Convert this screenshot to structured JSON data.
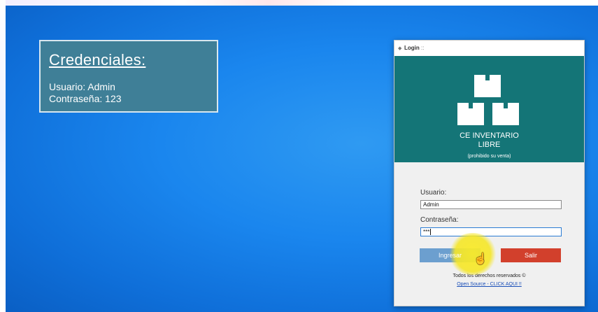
{
  "credentials": {
    "title": "Credenciales:",
    "user_line": "Usuario: Admin",
    "pass_line": "Contraseña: 123"
  },
  "login_window": {
    "title": "Login",
    "title_suffix": "::",
    "brand_line1": "CE INVENTARIO",
    "brand_line2": "LIBRE",
    "brand_note": "(prohibido su venta)",
    "user_label": "Usuario:",
    "user_value": "Admin",
    "pass_label": "Contraseña:",
    "pass_value": "***",
    "login_button": "Ingresar",
    "exit_button": "Salir",
    "rights_text": "Todos los derechos reservados ©",
    "open_source_link": "Open Source - CLICK AQUI !!"
  },
  "colors": {
    "desktop_blue": "#1a86ee",
    "credentials_bg": "#3f7f97",
    "banner_teal": "#147577",
    "login_button": "#6c9fcf",
    "exit_button": "#d2402c",
    "click_highlight": "#f5e628"
  }
}
